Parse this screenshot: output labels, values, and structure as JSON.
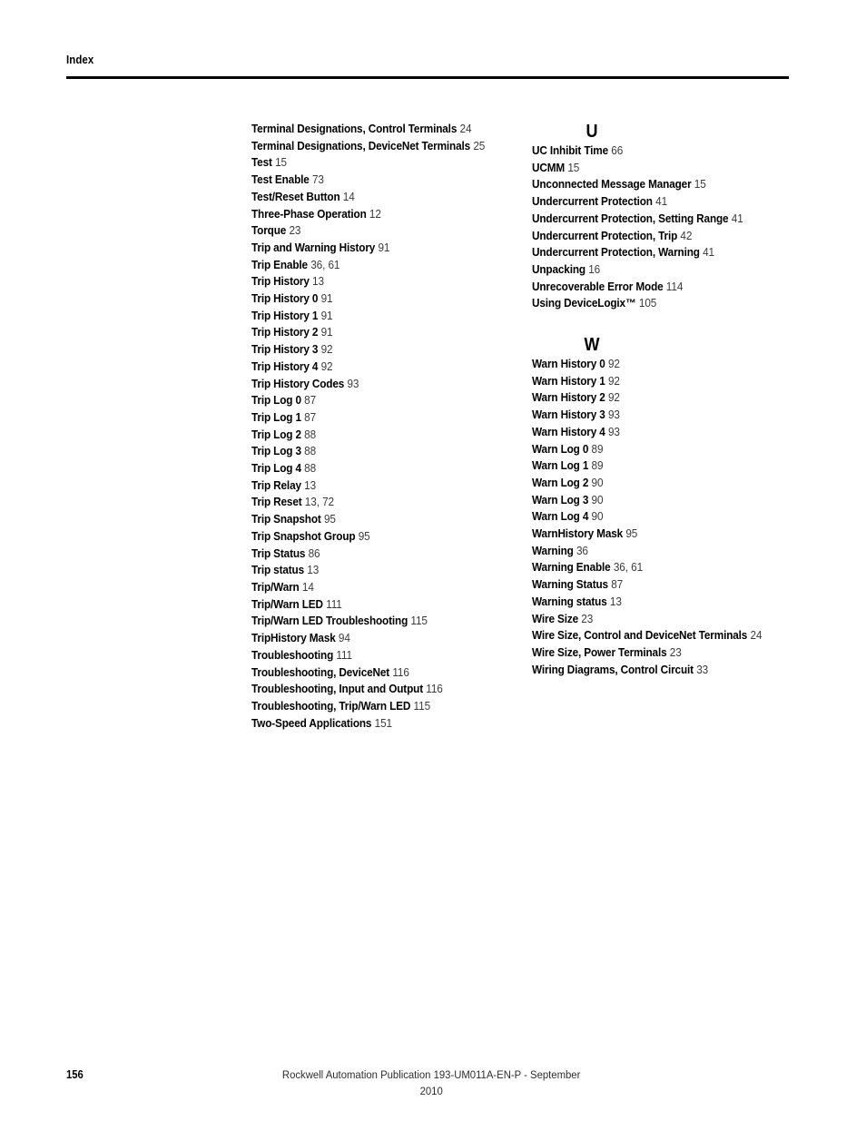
{
  "header": {
    "title": "Index"
  },
  "columns": {
    "left": {
      "sections": [
        {
          "letter": "",
          "entries": [
            {
              "term": "Terminal Designations, Control Terminals",
              "pages": "24"
            },
            {
              "term": "Terminal Designations, DeviceNet Terminals",
              "pages": "25"
            },
            {
              "term": "Test",
              "pages": "15"
            },
            {
              "term": "Test Enable",
              "pages": "73"
            },
            {
              "term": "Test/Reset Button",
              "pages": "14"
            },
            {
              "term": "Three-Phase Operation",
              "pages": "12"
            },
            {
              "term": "Torque",
              "pages": "23"
            },
            {
              "term": "Trip and Warning History",
              "pages": "91"
            },
            {
              "term": "Trip Enable",
              "pages": "36, 61"
            },
            {
              "term": "Trip History",
              "pages": "13"
            },
            {
              "term": "Trip History 0",
              "pages": "91"
            },
            {
              "term": "Trip History 1",
              "pages": "91"
            },
            {
              "term": "Trip History 2",
              "pages": "91"
            },
            {
              "term": "Trip History 3",
              "pages": "92"
            },
            {
              "term": "Trip History 4",
              "pages": "92"
            },
            {
              "term": "Trip History Codes",
              "pages": "93"
            },
            {
              "term": "Trip Log 0",
              "pages": "87"
            },
            {
              "term": "Trip Log 1",
              "pages": "87"
            },
            {
              "term": "Trip Log 2",
              "pages": "88"
            },
            {
              "term": "Trip Log 3",
              "pages": "88"
            },
            {
              "term": "Trip Log 4",
              "pages": "88"
            },
            {
              "term": "Trip Relay",
              "pages": "13"
            },
            {
              "term": "Trip Reset",
              "pages": "13, 72"
            },
            {
              "term": "Trip Snapshot",
              "pages": "95"
            },
            {
              "term": "Trip Snapshot Group",
              "pages": "95"
            },
            {
              "term": "Trip Status",
              "pages": "86"
            },
            {
              "term": "Trip status",
              "pages": "13"
            },
            {
              "term": "Trip/Warn",
              "pages": "14"
            },
            {
              "term": "Trip/Warn LED",
              "pages": "111"
            },
            {
              "term": "Trip/Warn LED Troubleshooting",
              "pages": "115"
            },
            {
              "term": "TripHistory Mask",
              "pages": "94"
            },
            {
              "term": "Troubleshooting",
              "pages": "111"
            },
            {
              "term": "Troubleshooting, DeviceNet",
              "pages": "116"
            },
            {
              "term": "Troubleshooting, Input and Output",
              "pages": "116"
            },
            {
              "term": "Troubleshooting, Trip/Warn LED",
              "pages": "115"
            },
            {
              "term": "Two-Speed Applications",
              "pages": "151"
            }
          ]
        }
      ]
    },
    "right": {
      "sections": [
        {
          "letter": "U",
          "entries": [
            {
              "term": "UC Inhibit Time",
              "pages": "66"
            },
            {
              "term": "UCMM",
              "pages": "15"
            },
            {
              "term": "Unconnected Message Manager",
              "pages": "15"
            },
            {
              "term": "Undercurrent Protection",
              "pages": "41"
            },
            {
              "term": "Undercurrent Protection, Setting Range",
              "pages": "41"
            },
            {
              "term": "Undercurrent Protection, Trip",
              "pages": "42"
            },
            {
              "term": "Undercurrent Protection, Warning",
              "pages": "41"
            },
            {
              "term": "Unpacking",
              "pages": "16"
            },
            {
              "term": "Unrecoverable Error Mode",
              "pages": "114"
            },
            {
              "term": "Using DeviceLogix™",
              "pages": "105"
            }
          ]
        },
        {
          "letter": "W",
          "entries": [
            {
              "term": "Warn History 0",
              "pages": "92"
            },
            {
              "term": "Warn History 1",
              "pages": "92"
            },
            {
              "term": "Warn History 2",
              "pages": "92"
            },
            {
              "term": "Warn History 3",
              "pages": "93"
            },
            {
              "term": "Warn History 4",
              "pages": "93"
            },
            {
              "term": "Warn Log 0",
              "pages": "89"
            },
            {
              "term": "Warn Log 1",
              "pages": "89"
            },
            {
              "term": "Warn Log 2",
              "pages": "90"
            },
            {
              "term": "Warn Log 3",
              "pages": "90"
            },
            {
              "term": "Warn Log 4",
              "pages": "90"
            },
            {
              "term": "WarnHistory Mask",
              "pages": "95"
            },
            {
              "term": "Warning",
              "pages": "36"
            },
            {
              "term": "Warning Enable",
              "pages": "36, 61"
            },
            {
              "term": "Warning Status",
              "pages": "87"
            },
            {
              "term": "Warning status",
              "pages": "13"
            },
            {
              "term": "Wire Size",
              "pages": "23"
            },
            {
              "term": "Wire Size, Control and DeviceNet Terminals",
              "pages": "24"
            },
            {
              "term": "Wire Size, Power Terminals",
              "pages": "23"
            },
            {
              "term": "Wiring Diagrams, Control Circuit",
              "pages": "33"
            }
          ]
        }
      ]
    }
  },
  "footer": {
    "page_number": "156",
    "publication": "Rockwell Automation Publication 193-UM011A-EN-P - September 2010"
  }
}
